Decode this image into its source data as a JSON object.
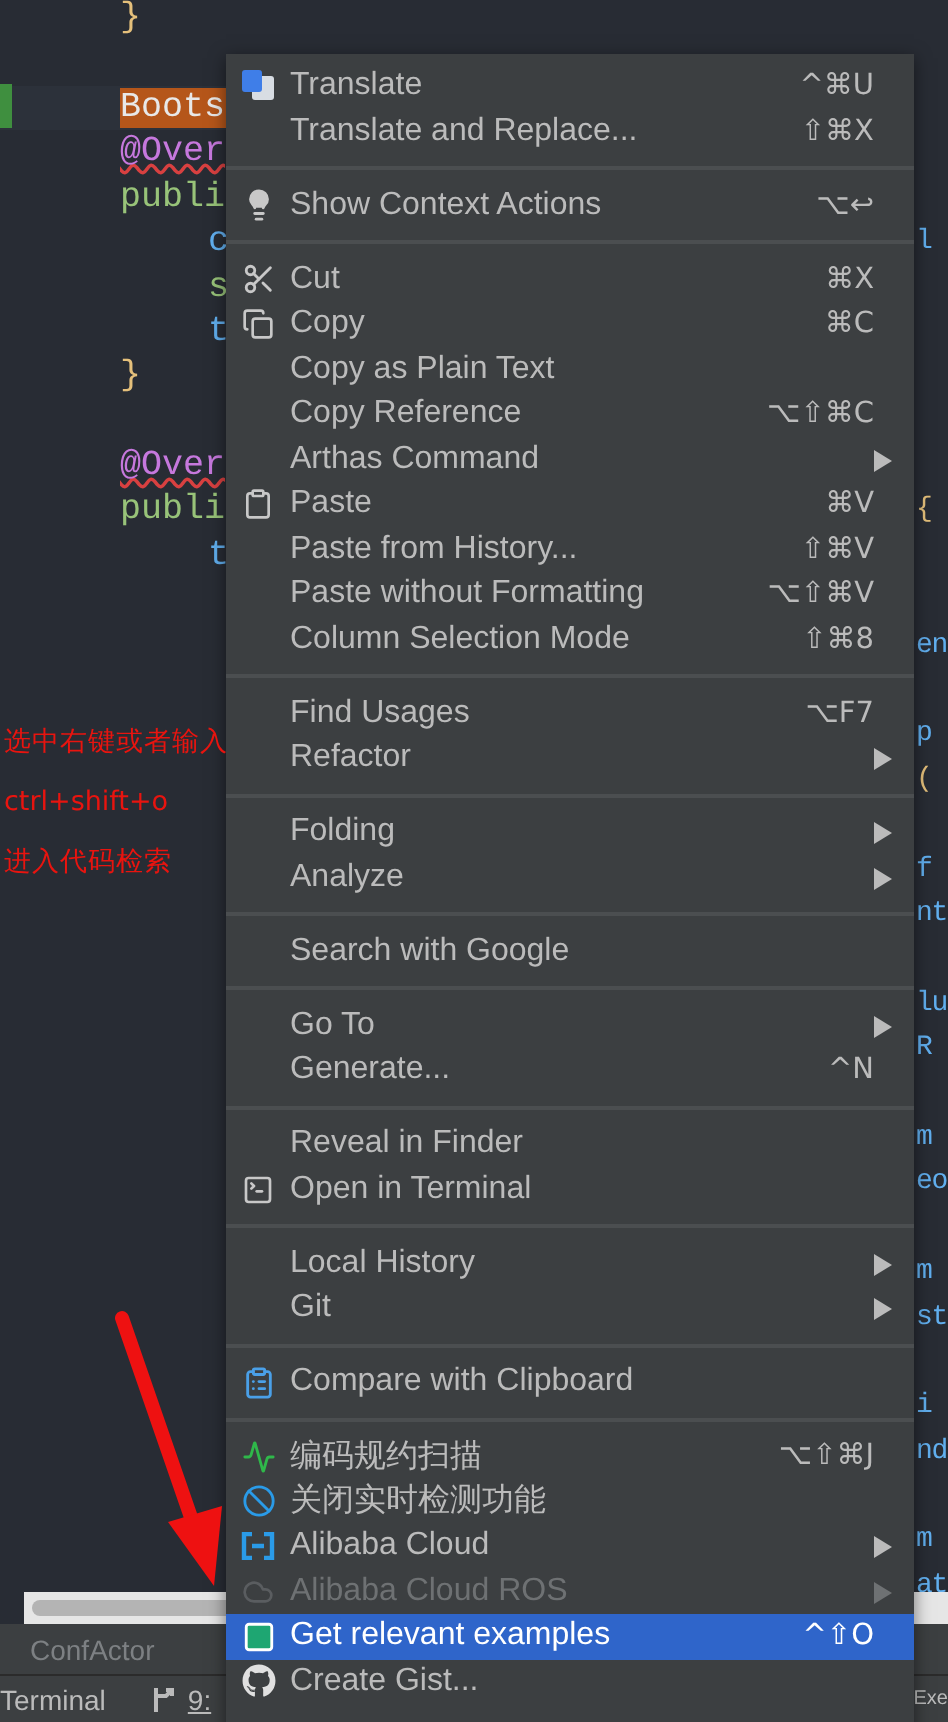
{
  "editor": {
    "blocks": [
      [
        {
          "left": {
            "text": "}",
            "kind": "brace"
          }
        }
      ],
      [
        {
          "left": {
            "text": "Boots",
            "kind": "highlight"
          },
          "current": true
        },
        {
          "left": {
            "text": "@Over",
            "kind": "annotation"
          }
        },
        {
          "left": {
            "text": "publi",
            "kind": "keyword"
          }
        },
        {
          "left": {
            "text": "c",
            "kind": "member"
          },
          "right": {
            "text": "l",
            "kind": "member"
          }
        },
        {
          "left": {
            "text": "s",
            "kind": "keyword-member"
          }
        },
        {
          "left": {
            "text": "t",
            "kind": "member"
          }
        },
        {
          "left": {
            "text": "}",
            "kind": "brace"
          }
        }
      ],
      [
        {
          "left": {
            "text": "@Over",
            "kind": "annotation"
          }
        },
        {
          "left": {
            "text": "publi",
            "kind": "keyword"
          },
          "right": {
            "text": "{",
            "kind": "brace"
          }
        },
        {
          "left": {
            "text": "t",
            "kind": "member"
          }
        }
      ],
      [
        {
          "right": {
            "text": "en",
            "kind": "member"
          }
        }
      ],
      [
        {
          "right": {
            "text": "p",
            "kind": "member"
          }
        },
        {
          "right": {
            "text": "(",
            "kind": "brace"
          }
        }
      ],
      [
        {
          "right": {
            "text": "f",
            "kind": "member"
          }
        },
        {
          "right": {
            "text": "nt",
            "kind": "member"
          }
        }
      ],
      [
        {
          "right": {
            "text": "lu",
            "kind": "member"
          }
        },
        {
          "right": {
            "text": "R",
            "kind": "member"
          }
        }
      ],
      [
        {
          "right": {
            "text": "m",
            "kind": "member"
          }
        },
        {
          "right": {
            "text": "eo",
            "kind": "member"
          }
        }
      ],
      [
        {
          "right": {
            "text": "m",
            "kind": "member"
          }
        },
        {
          "right": {
            "text": "st",
            "kind": "member"
          }
        }
      ],
      [
        {
          "right": {
            "text": "i",
            "kind": "member"
          }
        },
        {
          "right": {
            "text": "nd",
            "kind": "member"
          }
        }
      ],
      [
        {
          "right": {
            "text": "m",
            "kind": "member"
          }
        },
        {
          "right": {
            "text": "at",
            "kind": "member"
          }
        }
      ]
    ]
  },
  "tab_bar": {
    "tab": "ConfActor"
  },
  "status_bar": {
    "left": "Terminal",
    "branch": "9:",
    "right": "Exe"
  },
  "menu": {
    "groups": [
      [
        {
          "label": "Translate",
          "shortcut": "^⌘U",
          "submenu": false,
          "selected": false,
          "disabled": false
        },
        {
          "label": "Translate and Replace...",
          "shortcut": "⇧⌘X",
          "submenu": false,
          "selected": false,
          "disabled": false
        }
      ],
      [
        {
          "label": "Show Context Actions",
          "shortcut": "⌥↩",
          "submenu": false,
          "selected": false,
          "disabled": false
        }
      ],
      [
        {
          "label": "Cut",
          "shortcut": "⌘X",
          "submenu": false,
          "selected": false,
          "disabled": false
        },
        {
          "label": "Copy",
          "shortcut": "⌘C",
          "submenu": false,
          "selected": false,
          "disabled": false
        },
        {
          "label": "Copy as Plain Text",
          "submenu": false,
          "selected": false,
          "disabled": false
        },
        {
          "label": "Copy Reference",
          "shortcut": "⌥⇧⌘C",
          "submenu": false,
          "selected": false,
          "disabled": false
        },
        {
          "label": "Arthas Command",
          "submenu": true,
          "selected": false,
          "disabled": false
        },
        {
          "label": "Paste",
          "shortcut": "⌘V",
          "submenu": false,
          "selected": false,
          "disabled": false
        },
        {
          "label": "Paste from History...",
          "shortcut": "⇧⌘V",
          "submenu": false,
          "selected": false,
          "disabled": false
        },
        {
          "label": "Paste without Formatting",
          "shortcut": "⌥⇧⌘V",
          "submenu": false,
          "selected": false,
          "disabled": false
        },
        {
          "label": "Column Selection Mode",
          "shortcut": "⇧⌘8",
          "submenu": false,
          "selected": false,
          "disabled": false
        }
      ],
      [
        {
          "label": "Find Usages",
          "shortcut": "⌥F7",
          "submenu": false,
          "selected": false,
          "disabled": false
        },
        {
          "label": "Refactor",
          "submenu": true,
          "selected": false,
          "disabled": false
        }
      ],
      [
        {
          "label": "Folding",
          "submenu": true,
          "selected": false,
          "disabled": false
        },
        {
          "label": "Analyze",
          "submenu": true,
          "selected": false,
          "disabled": false
        }
      ],
      [
        {
          "label": "Search with Google",
          "submenu": false,
          "selected": false,
          "disabled": false
        }
      ],
      [
        {
          "label": "Go To",
          "submenu": true,
          "selected": false,
          "disabled": false
        },
        {
          "label": "Generate...",
          "shortcut": "^N",
          "submenu": false,
          "selected": false,
          "disabled": false
        }
      ],
      [
        {
          "label": "Reveal in Finder",
          "submenu": false,
          "selected": false,
          "disabled": false
        },
        {
          "label": "Open in Terminal",
          "submenu": false,
          "selected": false,
          "disabled": false
        }
      ],
      [
        {
          "label": "Local History",
          "submenu": true,
          "selected": false,
          "disabled": false
        },
        {
          "label": "Git",
          "submenu": true,
          "selected": false,
          "disabled": false
        }
      ],
      [
        {
          "label": "Compare with Clipboard",
          "submenu": false,
          "selected": false,
          "disabled": false
        }
      ],
      [
        {
          "label": "编码规约扫描",
          "shortcut": "⌥⇧⌘J",
          "submenu": false,
          "selected": false,
          "disabled": false
        },
        {
          "label": "关闭实时检测功能",
          "submenu": false,
          "selected": false,
          "disabled": false
        },
        {
          "label": "Alibaba Cloud",
          "submenu": true,
          "selected": false,
          "disabled": false
        },
        {
          "label": "Alibaba Cloud ROS",
          "submenu": true,
          "selected": false,
          "disabled": true
        },
        {
          "label": "Get relevant examples",
          "shortcut": "^⇧O",
          "submenu": false,
          "selected": true,
          "disabled": false
        },
        {
          "label": "Create Gist...",
          "submenu": false,
          "selected": false,
          "disabled": false
        }
      ]
    ]
  },
  "annotation": {
    "lines": [
      "选中右键或者输入",
      "ctrl+shift+o",
      "进入代码检索"
    ]
  }
}
